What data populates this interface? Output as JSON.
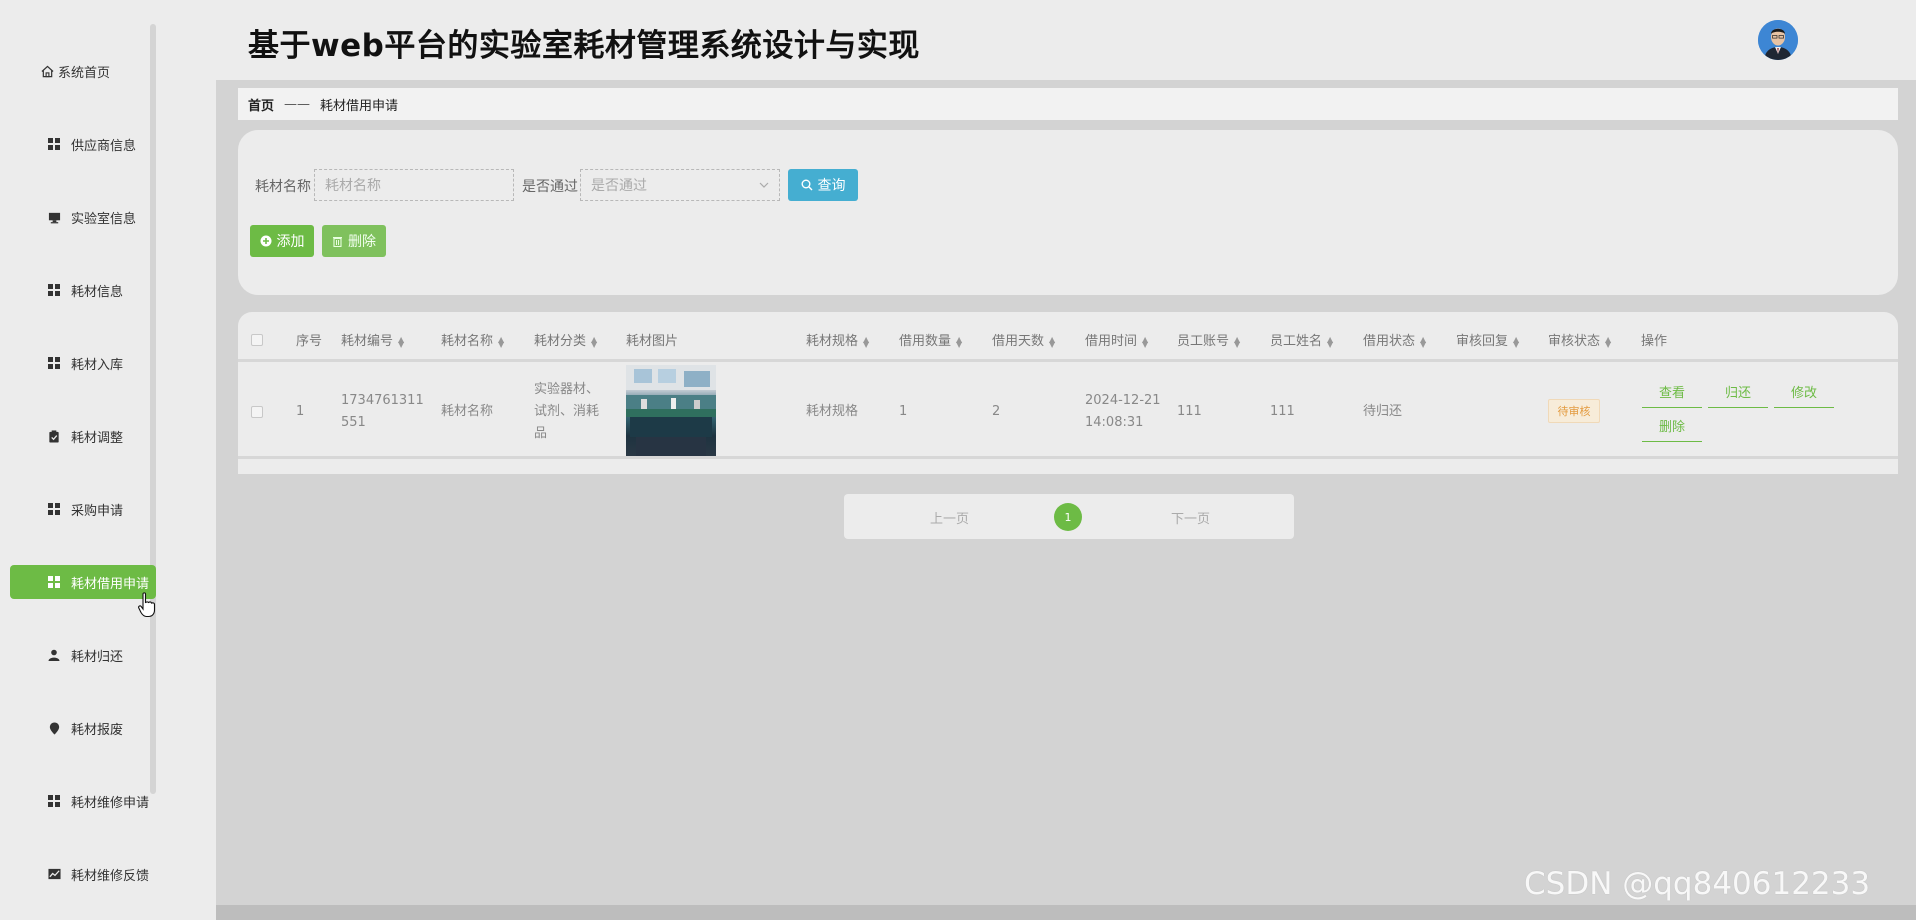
{
  "app": {
    "title": "基于web平台的实验室耗材管理系统设计与实现"
  },
  "sidebar": {
    "items": [
      {
        "label": "系统首页",
        "icon": "home-icon"
      },
      {
        "label": "供应商信息",
        "icon": "grid-icon"
      },
      {
        "label": "实验室信息",
        "icon": "monitor-icon"
      },
      {
        "label": "耗材信息",
        "icon": "grid-icon"
      },
      {
        "label": "耗材入库",
        "icon": "grid-icon"
      },
      {
        "label": "耗材调整",
        "icon": "clipboard-icon"
      },
      {
        "label": "采购申请",
        "icon": "grid-icon"
      },
      {
        "label": "耗材借用申请",
        "icon": "grid-icon",
        "active": true
      },
      {
        "label": "耗材归还",
        "icon": "user-icon"
      },
      {
        "label": "耗材报废",
        "icon": "pin-icon"
      },
      {
        "label": "耗材维修申请",
        "icon": "grid-icon"
      },
      {
        "label": "耗材维修反馈",
        "icon": "chart-icon"
      }
    ]
  },
  "breadcrumb": {
    "home": "首页",
    "separator": "——",
    "current": "耗材借用申请"
  },
  "search": {
    "name_label": "耗材名称",
    "name_placeholder": "耗材名称",
    "pass_label": "是否通过",
    "pass_placeholder": "是否通过",
    "query_button": "查询",
    "add_button": "添加",
    "delete_button": "删除"
  },
  "table": {
    "headers": {
      "index": "序号",
      "code": "耗材编号",
      "name": "耗材名称",
      "category": "耗材分类",
      "image": "耗材图片",
      "spec": "耗材规格",
      "qty": "借用数量",
      "days": "借用天数",
      "time": "借用时间",
      "account": "员工账号",
      "staff": "员工姓名",
      "borrow_status": "借用状态",
      "reply": "审核回复",
      "review_status": "审核状态",
      "ops": "操作"
    },
    "rows": [
      {
        "index": "1",
        "code_line1": "1734761311",
        "code_line2": "551",
        "name": "耗材名称",
        "category_line1": "实验器材、",
        "category_line2": "试剂、消耗",
        "category_line3": "品",
        "spec": "耗材规格",
        "qty": "1",
        "days": "2",
        "time_line1": "2024-12-21",
        "time_line2": "14:08:31",
        "account": "111",
        "staff": "111",
        "borrow_status": "待归还",
        "reply": "",
        "review_status": "待审核",
        "actions": {
          "view": "查看",
          "return": "归还",
          "edit": "修改",
          "delete": "删除"
        }
      }
    ]
  },
  "pagination": {
    "prev": "上一页",
    "current": "1",
    "next": "下一页"
  },
  "watermark": "CSDN @qq840612233",
  "colors": {
    "accent_green": "#6dbb45",
    "search_blue": "#45aed1",
    "badge_orange": "#e39b40"
  }
}
